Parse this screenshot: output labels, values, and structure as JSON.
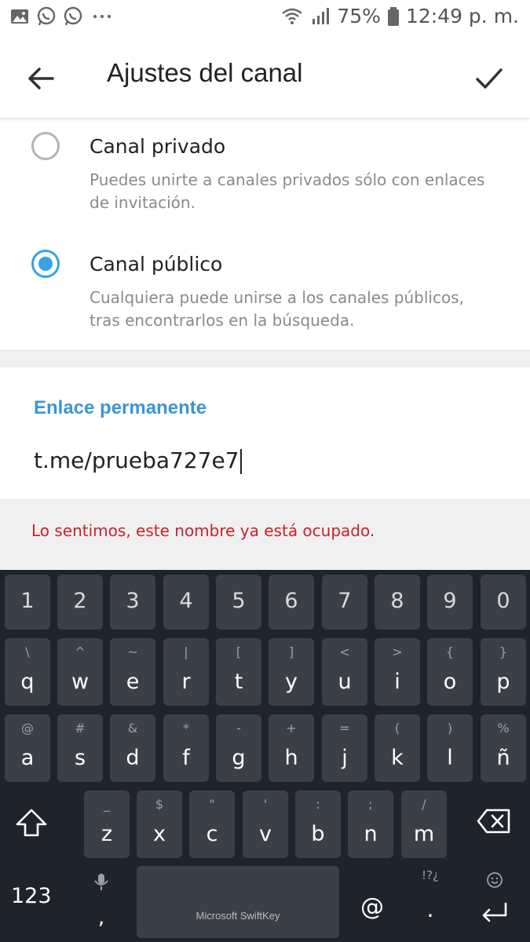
{
  "status_bar": {
    "left_icons": [
      "image-icon",
      "whatsapp-icon",
      "whatsapp-icon",
      "more-dots-icon"
    ],
    "battery": "75%",
    "time": "12:49 p. m."
  },
  "app_bar": {
    "title": "Ajustes del canal"
  },
  "channel_type": {
    "options": [
      {
        "label": "Canal privado",
        "description": "Puedes unirte a canales privados sólo con enlaces de invitación.",
        "selected": false
      },
      {
        "label": "Canal público",
        "description": "Cualquiera puede unirse a los canales públicos, tras encontrarlos en la búsqueda.",
        "selected": true
      }
    ]
  },
  "permalink": {
    "header": "Enlace permanente",
    "value": "t.me/prueba727e7"
  },
  "error": {
    "message": "Lo sentimos, este nombre ya está ocupado."
  },
  "keyboard": {
    "number_row": [
      "1",
      "2",
      "3",
      "4",
      "5",
      "6",
      "7",
      "8",
      "9",
      "0"
    ],
    "row1": [
      {
        "hint": "\\",
        "key": "q"
      },
      {
        "hint": "^",
        "key": "w"
      },
      {
        "hint": "~",
        "key": "e"
      },
      {
        "hint": "|",
        "key": "r"
      },
      {
        "hint": "[",
        "key": "t"
      },
      {
        "hint": "]",
        "key": "y"
      },
      {
        "hint": "<",
        "key": "u"
      },
      {
        "hint": ">",
        "key": "i"
      },
      {
        "hint": "{",
        "key": "o"
      },
      {
        "hint": "}",
        "key": "p"
      }
    ],
    "row2": [
      {
        "hint": "@",
        "key": "a"
      },
      {
        "hint": "#",
        "key": "s"
      },
      {
        "hint": "&",
        "key": "d"
      },
      {
        "hint": "*",
        "key": "f"
      },
      {
        "hint": "-",
        "key": "g"
      },
      {
        "hint": "+",
        "key": "h"
      },
      {
        "hint": "=",
        "key": "j"
      },
      {
        "hint": "(",
        "key": "k"
      },
      {
        "hint": ")",
        "key": "l"
      },
      {
        "hint": "%",
        "key": "ñ"
      }
    ],
    "row3": [
      {
        "hint": "_",
        "key": "z"
      },
      {
        "hint": "$",
        "key": "x"
      },
      {
        "hint": "\"",
        "key": "c"
      },
      {
        "hint": "'",
        "key": "v"
      },
      {
        "hint": ":",
        "key": "b"
      },
      {
        "hint": ";",
        "key": "n"
      },
      {
        "hint": "/",
        "key": "m"
      }
    ],
    "symbols_key": "123",
    "comma_key": ",",
    "space_label": "Microsoft SwiftKey",
    "at_key": "@",
    "punct_hint": "!?¿",
    "period_key": ".",
    "icons": [
      "shift-icon",
      "backspace-icon",
      "mic-icon",
      "emoji-icon",
      "enter-icon"
    ]
  }
}
